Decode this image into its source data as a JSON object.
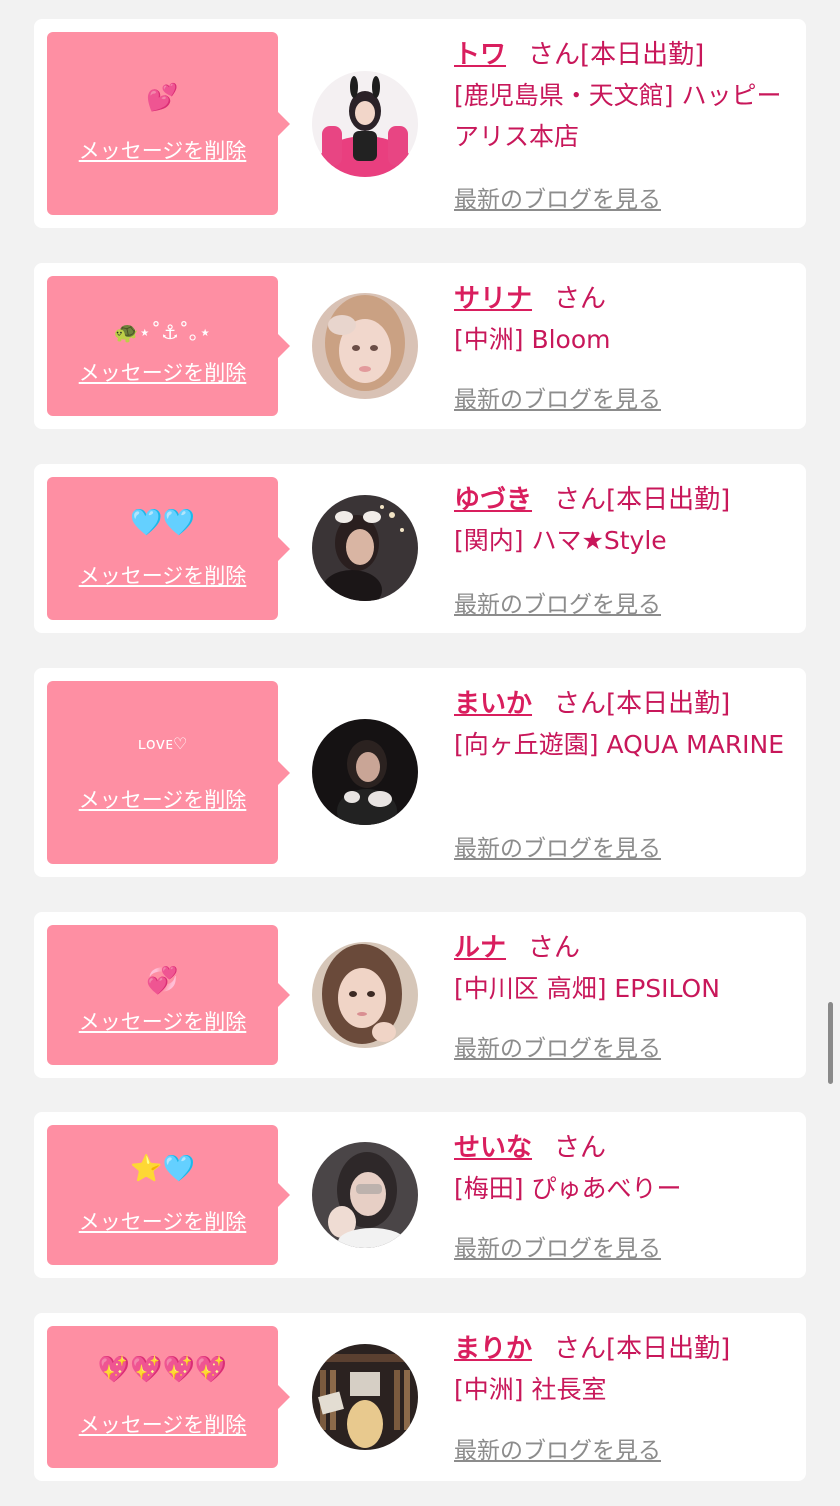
{
  "messages": [
    {
      "name": "トワ",
      "san": "さん",
      "status": "[本日出勤]",
      "store": "[鹿児島県・天文館] ハッピーアリス本店",
      "emoji": "💕",
      "delete_label": "メッセージを削除",
      "blog_label": "最新のブログを見る",
      "avatar_icon": "avatar-photo-pink-chair"
    },
    {
      "name": "サリナ",
      "san": "さん",
      "status": "",
      "store": "[中洲] Bloom",
      "emoji": "🐢⋆˚⚓︎˚｡⋆",
      "delete_label": "メッセージを削除",
      "blog_label": "最新のブログを見る",
      "avatar_icon": "avatar-photo-blonde"
    },
    {
      "name": "ゆづき",
      "san": "さん",
      "status": "[本日出勤]",
      "store": "[関内] ハマ★Style",
      "emoji": "🩵🩵",
      "delete_label": "メッセージを削除",
      "blog_label": "最新のブログを見る",
      "avatar_icon": "avatar-photo-night"
    },
    {
      "name": "まいか",
      "san": "さん",
      "status": "[本日出勤]",
      "store": "[向ヶ丘遊園] AQUA MARINE",
      "emoji": "ʟᴏᴠᴇ♡",
      "delete_label": "メッセージを削除",
      "blog_label": "最新のブログを見る",
      "avatar_icon": "avatar-photo-dark"
    },
    {
      "name": "ルナ",
      "san": "さん",
      "status": "",
      "store": "[中川区 高畑] EPSILON",
      "emoji": "💞",
      "delete_label": "メッセージを削除",
      "blog_label": "最新のブログを見る",
      "avatar_icon": "avatar-photo-brown-hair"
    },
    {
      "name": "せいな",
      "san": "さん",
      "status": "",
      "store": "[梅田] ぴゅあべりー",
      "emoji": "⭐️🩵",
      "delete_label": "メッセージを削除",
      "blog_label": "最新のブログを見る",
      "avatar_icon": "avatar-photo-blurred"
    },
    {
      "name": "まりか",
      "san": "さん",
      "status": "[本日出勤]",
      "store": "[中洲] 社長室",
      "emoji": "💖💖💖💖",
      "delete_label": "メッセージを削除",
      "blog_label": "最新のブログを見る",
      "avatar_icon": "avatar-photo-bookshelf"
    }
  ],
  "colors": {
    "background": "#f2f2f2",
    "card": "#ffffff",
    "bubble": "#fe8fa3",
    "name": "#d91e5e",
    "text_pink": "#c8175a",
    "link_gray": "#8c8c8c"
  }
}
